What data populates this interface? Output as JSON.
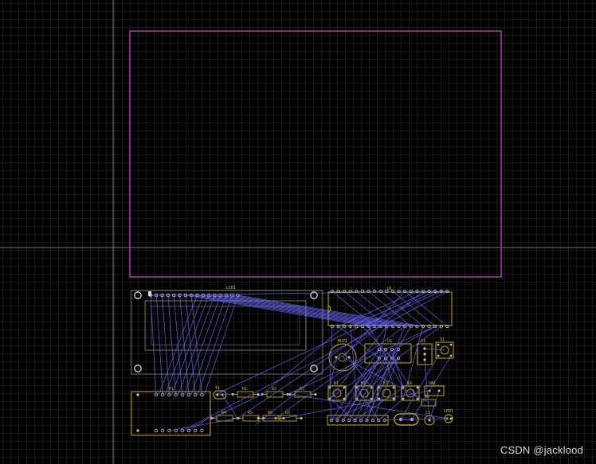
{
  "colors": {
    "background": "#000000",
    "grid": "#3c3c3c",
    "crosshair": "#9a9a9a",
    "board_outline": "#b43fbf",
    "silkscreen": "#e0b820",
    "ratsnest": "#6b6bff",
    "pad": "#c9c9c9"
  },
  "labels": {
    "lcd": "LCD1",
    "u1": "U1",
    "u2": "U2",
    "u3": "U3",
    "buzzer": "BUZ1",
    "p1": "P1",
    "r1": "R1",
    "r2": "R2",
    "r3": "R3",
    "r4": "R4",
    "r5": "R5",
    "r6": "R6",
    "r7": "R7",
    "c1": "C1",
    "c2": "C2",
    "q1": "Q1",
    "y1": "Y1",
    "s1": "S1",
    "sw1": "SW1",
    "k1": "K1",
    "k2": "K2",
    "k3": "K3",
    "k4": "K4",
    "d1": "D1",
    "led1": "LED1"
  },
  "watermark": "CSDN @jacklood"
}
